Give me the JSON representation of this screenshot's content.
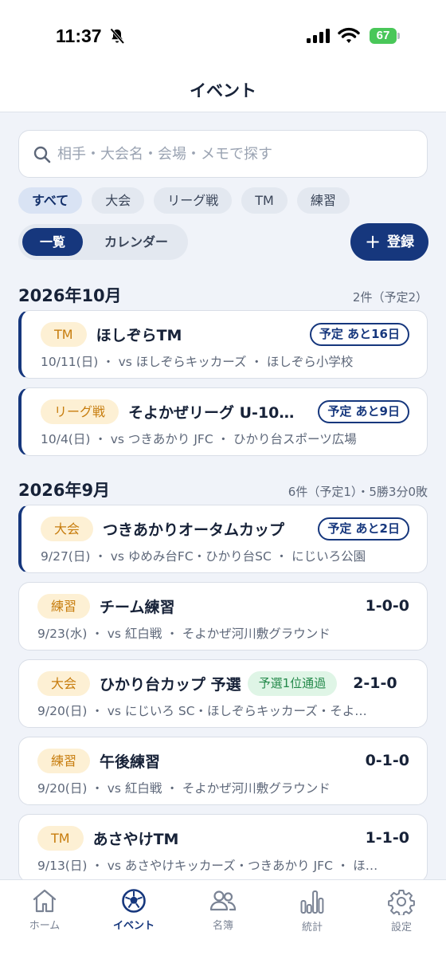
{
  "status": {
    "time": "11:37",
    "battery": "67"
  },
  "header": {
    "title": "イベント"
  },
  "search": {
    "placeholder": "相手・大会名・会場・メモで探す"
  },
  "filters": [
    "すべて",
    "大会",
    "リーグ戦",
    "TM",
    "練習"
  ],
  "view_toggle": {
    "list": "一覧",
    "calendar": "カレンダー"
  },
  "add_button": {
    "icon": "plus-icon",
    "label": "登録"
  },
  "months": [
    {
      "title": "2026年10月",
      "meta": "2件（予定2）",
      "events": [
        {
          "tag": "TM",
          "name": "ほしぞらTM",
          "badge": "予定 あと16日",
          "detail": "10/11(日) ・ vs ほしぞらキッカーズ ・ ほしぞら小学校"
        },
        {
          "tag": "リーグ戦",
          "name": "そよかぜリーグ U-10…",
          "badge": "予定 あと9日",
          "detail": "10/4(日) ・ vs つきあかり JFC ・ ひかり台スポーツ広場"
        }
      ]
    },
    {
      "title": "2026年9月",
      "meta": "6件（予定1）・5勝3分0敗",
      "events": [
        {
          "tag": "大会",
          "name": "つきあかりオータムカップ",
          "badge": "予定 あと2日",
          "detail": "9/27(日) ・ vs ゆめみ台FC・ひかり台SC ・ にじいろ公園"
        },
        {
          "tag": "練習",
          "name": "チーム練習",
          "score": "1-0-0",
          "detail": "9/23(水) ・ vs 紅白戦 ・ そよかぜ河川敷グラウンド"
        },
        {
          "tag": "大会",
          "name": "ひかり台カップ 予選",
          "result_badge": "予選1位通過",
          "score": "2-1-0",
          "detail": "9/20(日) ・ vs にじいろ SC・ほしぞらキッカーズ・そよ…"
        },
        {
          "tag": "練習",
          "name": "午後練習",
          "score": "0-1-0",
          "detail": "9/20(日) ・ vs 紅白戦 ・ そよかぜ河川敷グラウンド"
        },
        {
          "tag": "TM",
          "name": "あさやけTM",
          "score": "1-1-0",
          "detail": "9/13(日) ・ vs あさやけキッカーズ・つきあかり JFC ・ ほ…"
        }
      ]
    }
  ],
  "tabbar": [
    {
      "icon": "home-icon",
      "label": "ホーム"
    },
    {
      "icon": "soccer-ball-icon",
      "label": "イベント"
    },
    {
      "icon": "people-icon",
      "label": "名簿"
    },
    {
      "icon": "bar-chart-icon",
      "label": "統計"
    },
    {
      "icon": "gear-icon",
      "label": "設定"
    }
  ],
  "colors": {
    "primary": "#16377d",
    "tag_bg": "#fdf0d4",
    "tag_text": "#c77d0e",
    "success_bg": "#dff5e6",
    "success_text": "#23894a"
  }
}
